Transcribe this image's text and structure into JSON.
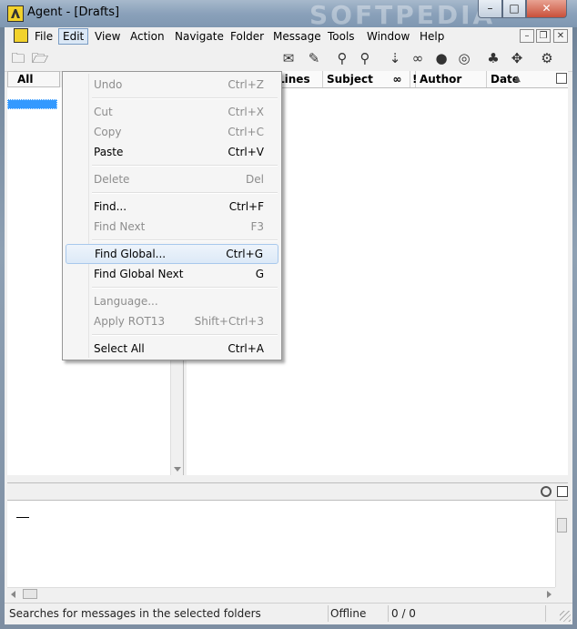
{
  "window": {
    "title": "Agent - [Drafts]",
    "watermark": "SOFTPEDIA",
    "caption_buttons": {
      "minimize": "–",
      "maximize": "□",
      "close": "✕"
    }
  },
  "menubar": {
    "items": [
      "File",
      "Edit",
      "View",
      "Action",
      "Navigate",
      "Folder",
      "Message",
      "Tools",
      "Window",
      "Help"
    ],
    "active": "Edit",
    "mdi_buttons": {
      "minimize": "–",
      "restore": "❐",
      "close": "✕"
    }
  },
  "toolbar": {
    "icons": [
      "folder-open-icon",
      "folder-refresh-icon",
      "new-post-icon",
      "reply-icon",
      "find-icon",
      "find-global-icon",
      "next-icon",
      "link-icon",
      "skip-icon",
      "mark-icon",
      "tree-icon",
      "expand-icon",
      "settings-icon"
    ]
  },
  "folder_pane": {
    "header": "All Folders"
  },
  "message_list": {
    "columns": [
      "Lines",
      "Subject",
      "!",
      "Author",
      "Date"
    ],
    "sort_indicator": "▲"
  },
  "edit_menu": {
    "items": [
      {
        "label": "Undo",
        "shortcut": "Ctrl+Z",
        "enabled": false
      },
      {
        "label": "Cut",
        "shortcut": "Ctrl+X",
        "enabled": false
      },
      {
        "label": "Copy",
        "shortcut": "Ctrl+C",
        "enabled": false
      },
      {
        "label": "Paste",
        "shortcut": "Ctrl+V",
        "enabled": true
      },
      {
        "label": "Delete",
        "shortcut": "Del",
        "enabled": false
      },
      {
        "label": "Find...",
        "shortcut": "Ctrl+F",
        "enabled": true
      },
      {
        "label": "Find Next",
        "shortcut": "F3",
        "enabled": false
      },
      {
        "label": "Find Global...",
        "shortcut": "Ctrl+G",
        "enabled": true,
        "highlighted": true
      },
      {
        "label": "Find Global Next",
        "shortcut": "G",
        "enabled": true
      },
      {
        "label": "Language...",
        "shortcut": "",
        "enabled": false
      },
      {
        "label": "Apply ROT13",
        "shortcut": "Shift+Ctrl+3",
        "enabled": false
      },
      {
        "label": "Select All",
        "shortcut": "Ctrl+A",
        "enabled": true
      }
    ]
  },
  "statusbar": {
    "message": "Searches for messages in the selected folders",
    "mode": "Offline",
    "count": "0 / 0"
  }
}
